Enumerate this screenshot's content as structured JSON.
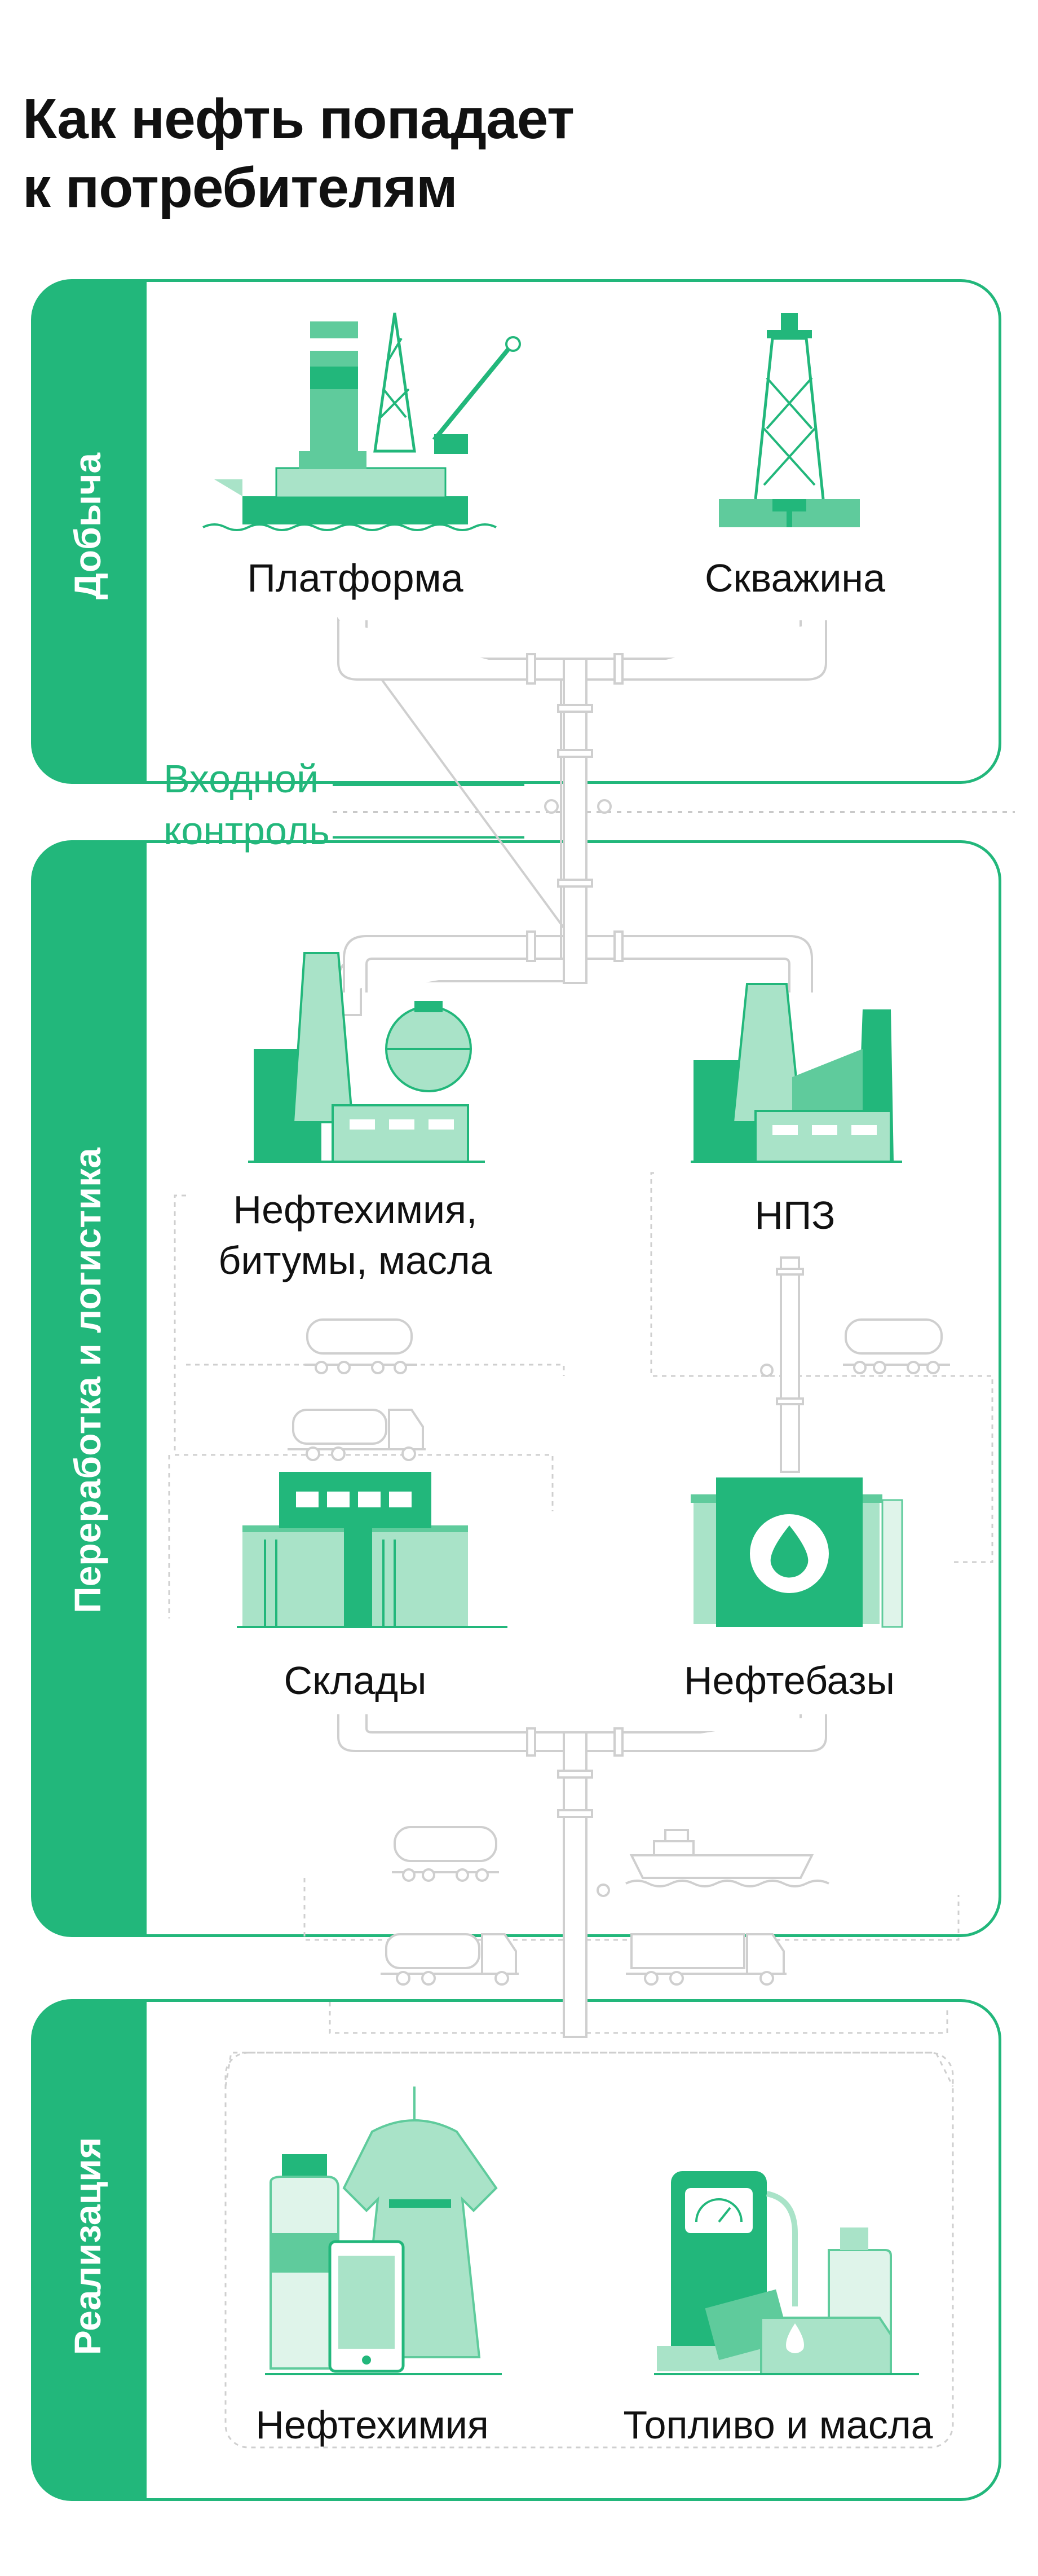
{
  "title": {
    "line1": "Как нефть попадает",
    "line2": "к потребителям"
  },
  "stages": {
    "extraction": "Добыча",
    "processing": "Переработка и логистика",
    "sales": "Реализация"
  },
  "control": {
    "line1": "Входной",
    "line2": "контроль"
  },
  "labels": {
    "platform": "Платформа",
    "well": "Скважина",
    "petrochem_line1": "Нефтехимия,",
    "petrochem_line2": "битумы, масла",
    "refinery": "НПЗ",
    "warehouses": "Склады",
    "oil_depots": "Нефтебазы",
    "petrochemistry": "Нефтехимия",
    "fuel_oils": "Топливо и масла"
  },
  "colors": {
    "primary": "#22b77b",
    "dark": "#1d9f6a",
    "mid": "#5fcb9c",
    "light": "#a9e3c8",
    "pale": "#dff4ea",
    "line": "#d6d6d6"
  }
}
